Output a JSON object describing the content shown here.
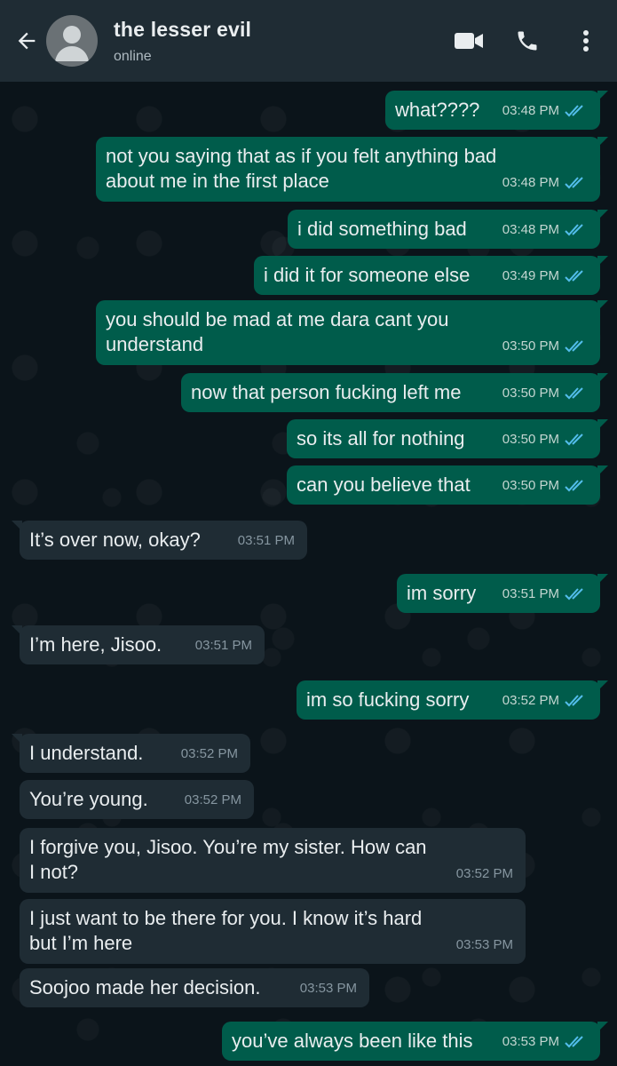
{
  "header": {
    "title": "the lesser evil",
    "status": "online",
    "icons": [
      "back-arrow-icon",
      "avatar",
      "video-call-icon",
      "voice-call-icon",
      "more-options-icon"
    ]
  },
  "colors": {
    "header_bg": "#1f2c34",
    "chat_bg": "#0b141a",
    "outgoing_bubble": "#005c4b",
    "incoming_bubble": "#1f2c34",
    "read_ticks": "#53bdeb"
  },
  "messages": [
    {
      "dir": "out",
      "text": "what????",
      "time": "03:48 PM",
      "read": true
    },
    {
      "dir": "out",
      "text": "not you saying that as if you felt anything bad\nabout me in the first place",
      "time": "03:48 PM",
      "read": true
    },
    {
      "dir": "out",
      "text": "i did something bad",
      "time": "03:48 PM",
      "read": true
    },
    {
      "dir": "out",
      "text": "i did it for someone else",
      "time": "03:49 PM",
      "read": true
    },
    {
      "dir": "out",
      "text": "you should be mad at me dara cant you\nunderstand",
      "time": "03:50 PM",
      "read": true
    },
    {
      "dir": "out",
      "text": "now that person fucking left me",
      "time": "03:50 PM",
      "read": true
    },
    {
      "dir": "out",
      "text": "so its all for nothing",
      "time": "03:50 PM",
      "read": true
    },
    {
      "dir": "out",
      "text": "can you believe that",
      "time": "03:50 PM",
      "read": true
    },
    {
      "dir": "in",
      "text": "It’s over now, okay?",
      "time": "03:51 PM"
    },
    {
      "dir": "out",
      "text": "im sorry",
      "time": "03:51 PM",
      "read": true
    },
    {
      "dir": "in",
      "text": "I’m here, Jisoo.",
      "time": "03:51 PM"
    },
    {
      "dir": "out",
      "text": "im so fucking sorry",
      "time": "03:52 PM",
      "read": true
    },
    {
      "dir": "in",
      "text": "I understand.",
      "time": "03:52 PM"
    },
    {
      "dir": "in",
      "text": "You’re young.",
      "time": "03:52 PM"
    },
    {
      "dir": "in",
      "text": "I forgive you, Jisoo. You’re my sister. How can\nI not?",
      "time": "03:52 PM"
    },
    {
      "dir": "in",
      "text": "I just want to be there for you. I know it’s hard\nbut I’m here",
      "time": "03:53 PM"
    },
    {
      "dir": "in",
      "text": "Soojoo made her decision.",
      "time": "03:53 PM"
    },
    {
      "dir": "out",
      "text": "you’ve always been like this",
      "time": "03:53 PM",
      "read": true
    }
  ]
}
